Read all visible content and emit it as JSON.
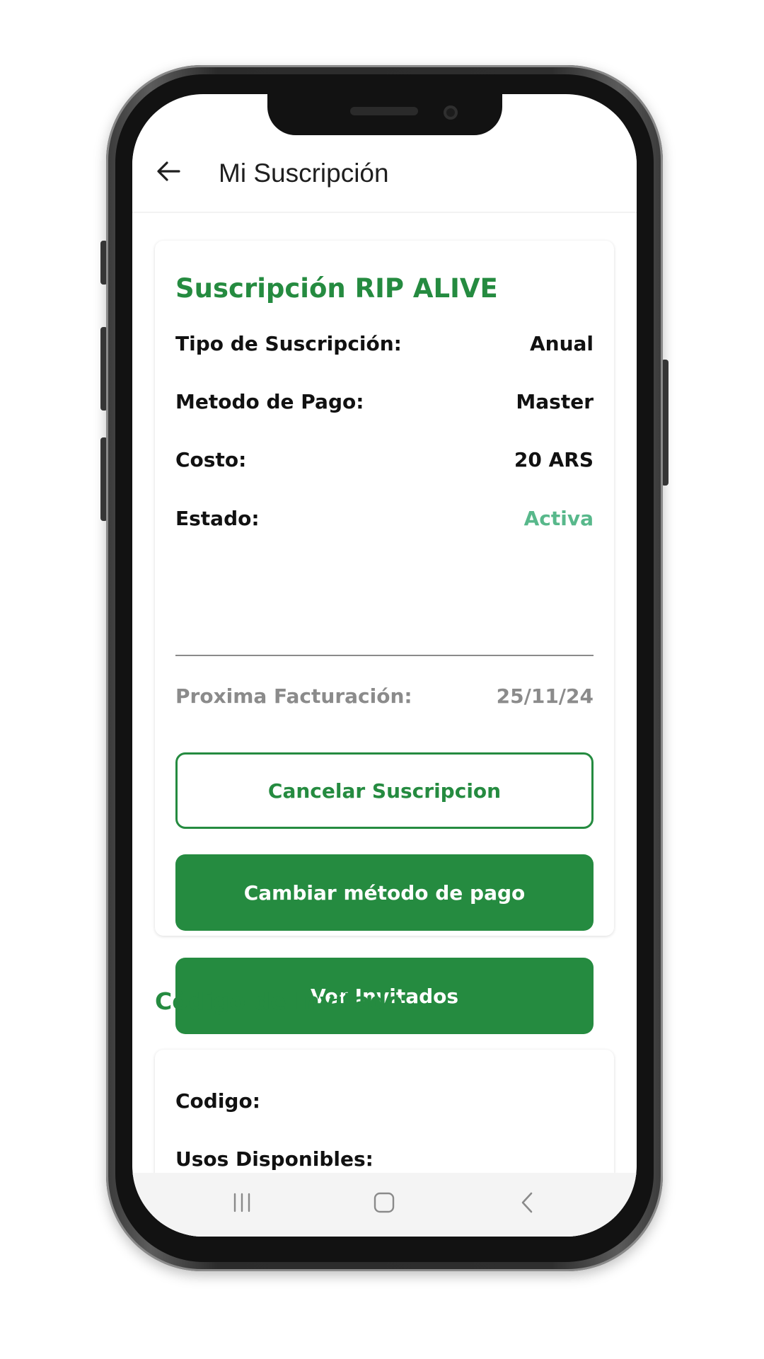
{
  "header": {
    "title": "Mi Suscripción",
    "back_icon": "arrow-left-icon"
  },
  "subscription": {
    "title": "Suscripción RIP ALIVE",
    "rows": [
      {
        "label": "Tipo de Suscripción:",
        "value": "Anual"
      },
      {
        "label": "Metodo de Pago:",
        "value": "Master"
      },
      {
        "label": "Costo:",
        "value": "20 ARS"
      },
      {
        "label": "Estado:",
        "value": "Activa"
      }
    ],
    "next_billing": {
      "label": "Proxima Facturación:",
      "value": "25/11/24"
    },
    "buttons": {
      "cancel": "Cancelar Suscripcion",
      "change_payment": "Cambiar método de pago",
      "view_guests": "Ver Invitados"
    }
  },
  "guest_code": {
    "section_title": "Código de Invitado",
    "rows": [
      {
        "label": "Codigo:",
        "value": ""
      },
      {
        "label": "Usos Disponibles:",
        "value": ""
      }
    ]
  },
  "nav_bar": {
    "icons": [
      "recent-apps-icon",
      "home-icon",
      "back-icon"
    ]
  },
  "colors": {
    "accent": "#258b40",
    "status_active": "#58b88b",
    "muted_text": "#8b8b8b"
  }
}
